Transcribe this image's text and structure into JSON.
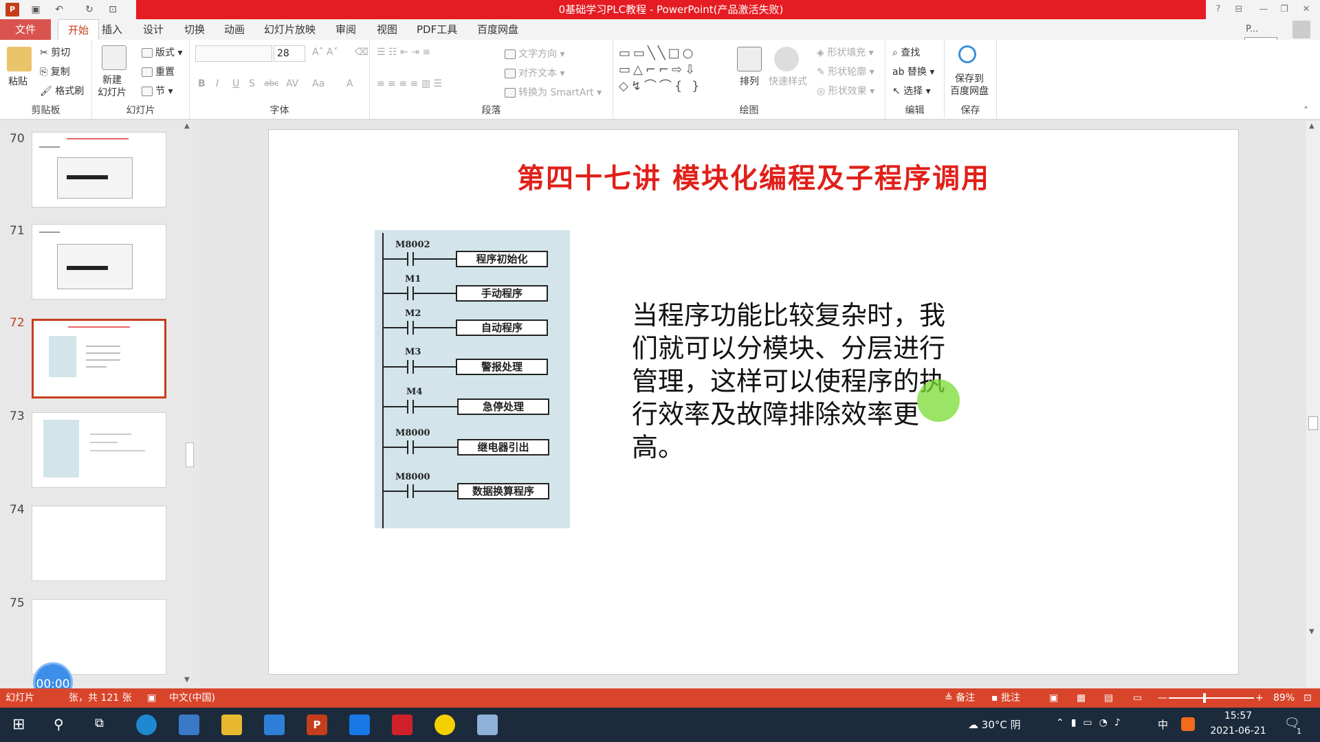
{
  "app": {
    "title": "0基础学习PLC教程 - PowerPoint(产品激活失败)",
    "signin_label": "P...",
    "tooltip": "开始"
  },
  "menu": {
    "tabs": [
      "文件",
      "开始",
      "插入",
      "设计",
      "切换",
      "动画",
      "幻灯片放映",
      "审阅",
      "视图",
      "PDF工具",
      "百度网盘"
    ]
  },
  "ribbon": {
    "clipboard": {
      "paste": "粘贴",
      "cut": "剪切",
      "copy": "复制",
      "format_painter": "格式刷",
      "label": "剪贴板"
    },
    "slides": {
      "new_slide": "新建\n幻灯片",
      "layout": "版式",
      "reset": "重置",
      "section": "节",
      "label": "幻灯片"
    },
    "font": {
      "size": "28",
      "label": "字体",
      "bold": "B",
      "italic": "I",
      "underline": "U",
      "shadow": "S",
      "strike": "abc",
      "spacing": "AV",
      "case": "Aa",
      "color": "A"
    },
    "paragraph": {
      "text_direction": "文字方向",
      "align_text": "对齐文本",
      "smartart": "转换为 SmartArt",
      "label": "段落"
    },
    "drawing": {
      "arrange": "排列",
      "quick_styles": "快速样式",
      "shape_fill": "形状填充",
      "shape_outline": "形状轮廓",
      "shape_effects": "形状效果",
      "label": "绘图"
    },
    "editing": {
      "find": "查找",
      "replace": "替换",
      "select": "选择",
      "label": "编辑"
    },
    "save": {
      "save_baidu": "保存到\n百度网盘",
      "label": "保存"
    }
  },
  "thumbnails": [
    {
      "num": "70"
    },
    {
      "num": "71"
    },
    {
      "num": "72",
      "selected": true
    },
    {
      "num": "73"
    },
    {
      "num": "74"
    },
    {
      "num": "75"
    }
  ],
  "slide": {
    "title": "第四十七讲  模块化编程及子程序调用",
    "body": "当程序功能比较复杂时，我们就可以分模块、分层进行管理，这样可以使程序的执行效率及故障排除效率更高。",
    "rungs": [
      {
        "contact": "M8002",
        "coil": "程序初始化"
      },
      {
        "contact": "M1",
        "coil": "手动程序"
      },
      {
        "contact": "M2",
        "coil": "自动程序"
      },
      {
        "contact": "M3",
        "coil": "警报处理"
      },
      {
        "contact": "M4",
        "coil": "急停处理"
      },
      {
        "contact": "M8000",
        "coil": "继电器引出"
      },
      {
        "contact": "M8000",
        "coil": "数据换算程序"
      }
    ]
  },
  "timer": "00:00",
  "status": {
    "slide_info": "幻灯片",
    "total": "张，共 121 张",
    "language": "中文(中国)",
    "notes": "备注",
    "comments": "批注",
    "zoom": "89%"
  },
  "taskbar": {
    "weather": "30°C 阴",
    "ime": "中",
    "time": "15:57",
    "date": "2021-06-21",
    "notification_count": "1"
  }
}
